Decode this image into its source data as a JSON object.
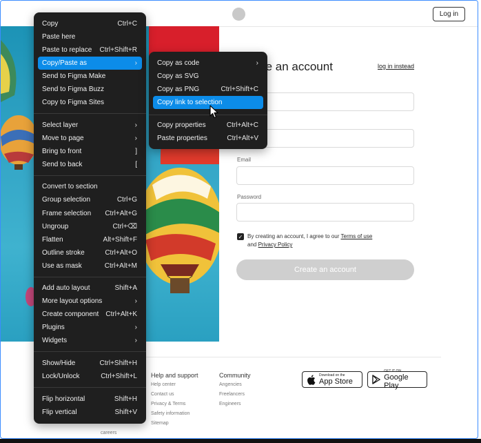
{
  "topbar": {
    "login_label": "Log in"
  },
  "form": {
    "title": "Create an account",
    "instead_link": "log in instead",
    "email_label": "Email",
    "password_label": "Password",
    "consent_prefix": "By creating an account, I agree to our",
    "terms_label": "Terms of use",
    "consent_and": "and",
    "privacy_label": "Privacy Policy",
    "create_label": "Create an account"
  },
  "footer": {
    "left_links": [
      "careers"
    ],
    "help": {
      "title": "Help and support",
      "links": [
        "Help center",
        "Contact us",
        "Privacy & Terms",
        "Safety information",
        "Sitemap"
      ]
    },
    "community": {
      "title": "Community",
      "links": [
        "Angencies",
        "Freelancers",
        "Engineers"
      ]
    },
    "appstore": {
      "small": "Download on the",
      "big": "App Store"
    },
    "googleplay": {
      "small": "GET IT ON",
      "big": "Google Play"
    }
  },
  "context_menu": {
    "items": [
      {
        "label": "Copy",
        "shortcut": "Ctrl+C"
      },
      {
        "label": "Paste here",
        "shortcut": ""
      },
      {
        "label": "Paste to replace",
        "shortcut": "Ctrl+Shift+R"
      },
      {
        "label": "Copy/Paste as",
        "shortcut": "›"
      },
      {
        "label": "Send to Figma Make",
        "shortcut": ""
      },
      {
        "label": "Send to Figma Buzz",
        "shortcut": ""
      },
      {
        "label": "Copy to Figma Sites",
        "shortcut": ""
      },
      {
        "label": "Select layer",
        "shortcut": "›"
      },
      {
        "label": "Move to page",
        "shortcut": "›"
      },
      {
        "label": "Bring to front",
        "shortcut": "]"
      },
      {
        "label": "Send to back",
        "shortcut": "["
      },
      {
        "label": "Convert to section",
        "shortcut": ""
      },
      {
        "label": "Group selection",
        "shortcut": "Ctrl+G"
      },
      {
        "label": "Frame selection",
        "shortcut": "Ctrl+Alt+G"
      },
      {
        "label": "Ungroup",
        "shortcut": "Ctrl+⌫"
      },
      {
        "label": "Flatten",
        "shortcut": "Alt+Shift+F"
      },
      {
        "label": "Outline stroke",
        "shortcut": "Ctrl+Alt+O"
      },
      {
        "label": "Use as mask",
        "shortcut": "Ctrl+Alt+M"
      },
      {
        "label": "Add auto layout",
        "shortcut": "Shift+A"
      },
      {
        "label": "More layout options",
        "shortcut": "›"
      },
      {
        "label": "Create component",
        "shortcut": "Ctrl+Alt+K"
      },
      {
        "label": "Plugins",
        "shortcut": "›"
      },
      {
        "label": "Widgets",
        "shortcut": "›"
      },
      {
        "label": "Show/Hide",
        "shortcut": "Ctrl+Shift+H"
      },
      {
        "label": "Lock/Unlock",
        "shortcut": "Ctrl+Shift+L"
      },
      {
        "label": "Flip horizontal",
        "shortcut": "Shift+H"
      },
      {
        "label": "Flip vertical",
        "shortcut": "Shift+V"
      }
    ]
  },
  "submenu": {
    "items": [
      {
        "label": "Copy as code",
        "shortcut": "›"
      },
      {
        "label": "Copy as SVG",
        "shortcut": ""
      },
      {
        "label": "Copy as PNG",
        "shortcut": "Ctrl+Shift+C"
      },
      {
        "label": "Copy link to selection",
        "shortcut": ""
      },
      {
        "label": "Copy properties",
        "shortcut": "Ctrl+Alt+C"
      },
      {
        "label": "Paste properties",
        "shortcut": "Ctrl+Alt+V"
      }
    ]
  },
  "colors": {
    "accent": "#0c8ce9",
    "menu_bg": "#1f1f1f",
    "button_disabled": "#cfcfcf"
  }
}
